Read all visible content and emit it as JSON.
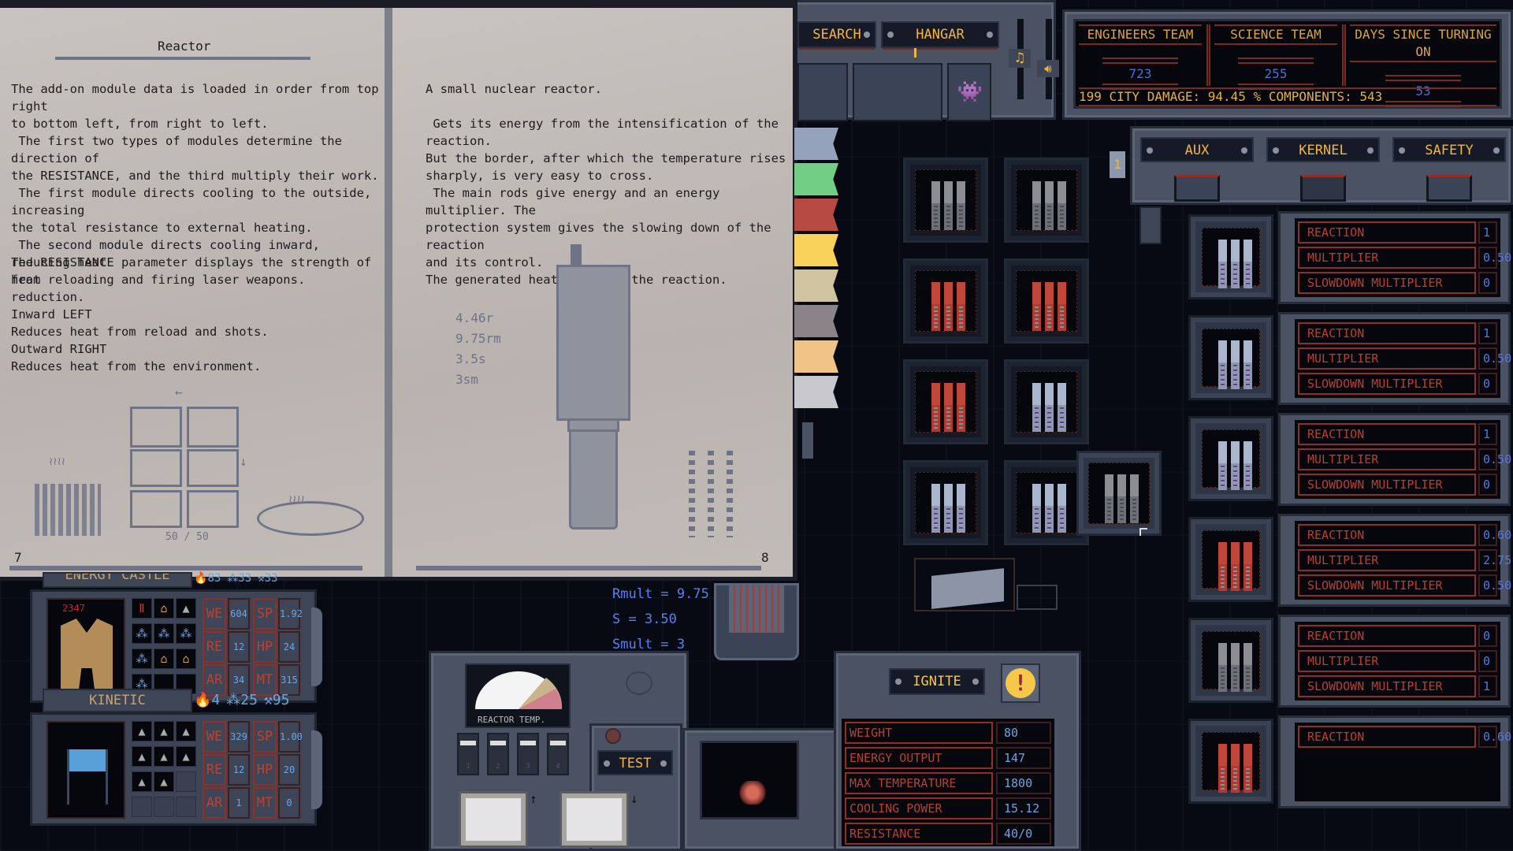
{
  "manual": {
    "left_page": {
      "title": "Reactor",
      "paragraphs": [
        "The add-on module data is loaded in order from top right\nto bottom left, from right to left.",
        " The first two types of modules determine the direction of\nthe RESISTANCE, and the third multiply their work.\n The first module directs cooling to the outside, increasing\nthe total resistance to external heating.\n The second module directs cooling inward, reducing heat\nfrom reloading and firing laser weapons.",
        "The RESISTANCE parameter displays the strength of heat\nreduction.\nInward LEFT\nReduces heat from reload and shots.\nOutward RIGHT\nReduces heat from the environment."
      ],
      "diagram_label": "50 / 50",
      "page_number": "7"
    },
    "right_page": {
      "paragraphs": [
        "A small nuclear reactor.",
        " Gets its energy from the intensification of the reaction.\nBut the border, after which the temperature rises\nsharply, is very easy to cross.\n The main rods give energy and an energy multiplier. The\nprotection system gives the slowing down of the reaction\nand its control.\nThe generated heat enhances the reaction."
      ],
      "diagram_values": [
        "4.46r",
        "9.75rm",
        "3.5s",
        "3sm"
      ],
      "page_number": "8"
    },
    "bookmarks": [
      {
        "color": "#94a2bb",
        "name": "bookmark-blue"
      },
      {
        "color": "#72cd85",
        "name": "bookmark-green"
      },
      {
        "color": "#b74a40",
        "name": "bookmark-red"
      },
      {
        "color": "#f9d25b",
        "name": "bookmark-yellow"
      },
      {
        "color": "#cfc3a0",
        "name": "bookmark-tan"
      },
      {
        "color": "#8a8488",
        "name": "bookmark-grey"
      },
      {
        "color": "#f0c489",
        "name": "bookmark-orange"
      },
      {
        "color": "#c9c9cd",
        "name": "bookmark-white"
      }
    ]
  },
  "top_nav": {
    "tabs": [
      {
        "label": "SEARCH",
        "active": false
      },
      {
        "label": "HANGAR",
        "active": true
      }
    ],
    "music_icon": "music-note-icon",
    "sound_icon": "speaker-icon",
    "invader_icon": "space-invader-icon"
  },
  "stats": {
    "engineers_team": {
      "label": "ENGINEERS TEAM",
      "value": "723"
    },
    "science_team": {
      "label": "SCIENCE TEAM",
      "value": "255"
    },
    "days": {
      "label": "DAYS SINCE TURNING ON",
      "value": "53"
    },
    "ticker": "199  CITY DAMAGE: 94.45 %  COMPONENTS: 543"
  },
  "module_tabs": [
    "AUX",
    "KERNEL",
    "SAFETY"
  ],
  "side_counter": "1",
  "reactor_grid": {
    "cells": [
      {
        "rod": "grey"
      },
      {
        "rod": "grey"
      },
      {
        "rod": "red"
      },
      {
        "rod": "red"
      },
      {
        "rod": "red"
      },
      {
        "rod": "blue"
      },
      {
        "rod": "blue"
      },
      {
        "rod": "blue"
      }
    ],
    "dragged_cell": {
      "rod": "grey"
    }
  },
  "modules": [
    {
      "rod": "blue",
      "rows": [
        {
          "label": "REACTION",
          "value": "1"
        },
        {
          "label": "MULTIPLIER",
          "value": "0.50"
        },
        {
          "label": "SLOWDOWN MULTIPLIER",
          "value": "0"
        }
      ]
    },
    {
      "rod": "blue",
      "rows": [
        {
          "label": "REACTION",
          "value": "1"
        },
        {
          "label": "MULTIPLIER",
          "value": "0.50"
        },
        {
          "label": "SLOWDOWN MULTIPLIER",
          "value": "0"
        }
      ]
    },
    {
      "rod": "blue",
      "rows": [
        {
          "label": "REACTION",
          "value": "1"
        },
        {
          "label": "MULTIPLIER",
          "value": "0.50"
        },
        {
          "label": "SLOWDOWN MULTIPLIER",
          "value": "0"
        }
      ]
    },
    {
      "rod": "red",
      "rows": [
        {
          "label": "REACTION",
          "value": "0.60"
        },
        {
          "label": "MULTIPLIER",
          "value": "2.75"
        },
        {
          "label": "SLOWDOWN MULTIPLIER",
          "value": "0.50"
        }
      ]
    },
    {
      "rod": "grey",
      "rows": [
        {
          "label": "REACTION",
          "value": "0"
        },
        {
          "label": "MULTIPLIER",
          "value": "0"
        },
        {
          "label": "SLOWDOWN MULTIPLIER",
          "value": "1"
        }
      ]
    },
    {
      "rod": "red",
      "rows": [
        {
          "label": "REACTION",
          "value": "0.60"
        }
      ]
    }
  ],
  "units": [
    {
      "name": "ENERGY CASTLE",
      "resources": [
        "83",
        "33",
        "33"
      ],
      "hp_counter": "2347",
      "stats": {
        "WE": "604",
        "SP": "1.92",
        "RE": "12",
        "HP": "24",
        "AR": "34",
        "MT": "315"
      }
    },
    {
      "name": "KINETIC",
      "resources": [
        "4",
        "25",
        "95"
      ],
      "stats": {
        "WE": "329",
        "SP": "1.00",
        "RE": "12",
        "HP": "20",
        "AR": "1",
        "MT": "0"
      }
    }
  ],
  "formulas": {
    "rmult": "Rmult = 9.75",
    "s": "S = 3.50",
    "smult": "Smult = 3"
  },
  "control_panel": {
    "gauge_label": "REACTOR TEMP.",
    "switches": [
      "1",
      "2",
      "3",
      "4"
    ],
    "test_button": "TEST"
  },
  "reactor_summary": {
    "ignite_button": "IGNITE",
    "warning_icon": "exclamation-icon",
    "rows": [
      {
        "label": "WEIGHT",
        "value": "80"
      },
      {
        "label": "ENERGY OUTPUT",
        "value": "147"
      },
      {
        "label": "MAX TEMPERATURE",
        "value": "1800"
      },
      {
        "label": "COOLING POWER",
        "value": "15.12"
      },
      {
        "label": "RESISTANCE",
        "value": "40/0"
      }
    ]
  }
}
